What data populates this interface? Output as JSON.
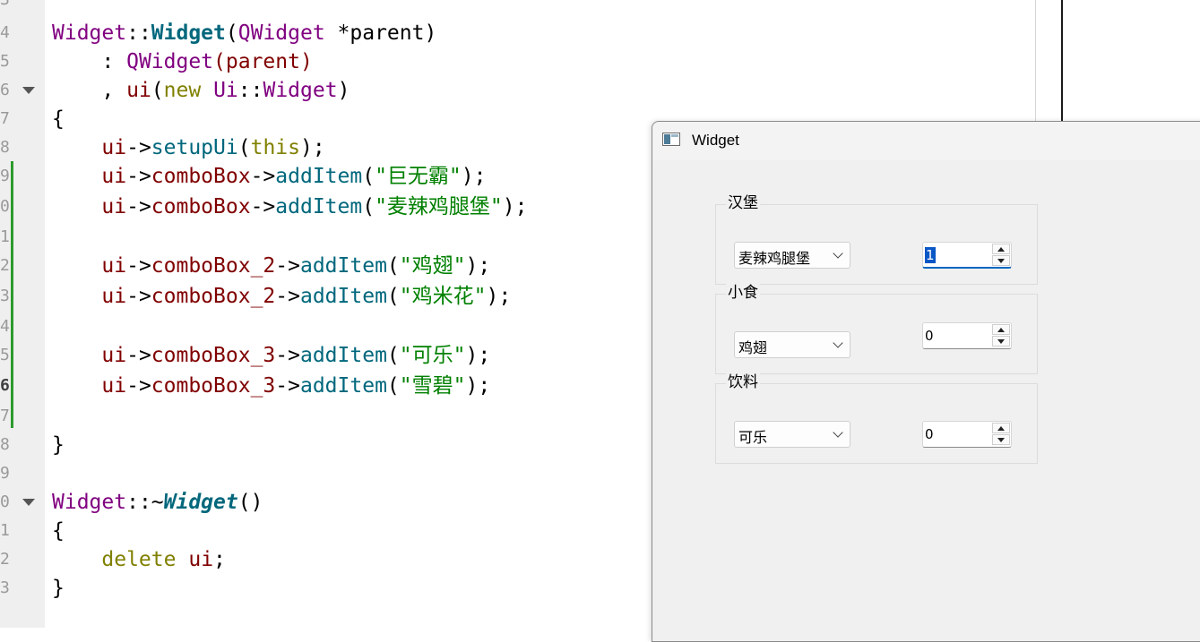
{
  "editor": {
    "line_numbers": [
      "3",
      "4",
      "5",
      "6",
      "7",
      "8",
      "9",
      "0",
      "1",
      "2",
      "3",
      "4",
      "5",
      "6",
      "7",
      "8",
      "9",
      "0",
      "1",
      "2",
      "3"
    ],
    "current_line_number": "6",
    "code": {
      "l4": {
        "cls": "Widget",
        "sep": "::",
        "fn": "Widget",
        "args_open": "(",
        "type": "QWidget",
        "rest": " *parent)"
      },
      "l5": {
        "lead": "    : ",
        "cls": "QWidget",
        "rest": "(parent)"
      },
      "l6": {
        "lead": "    , ",
        "member": "ui",
        "open": "(",
        "kw": "new",
        "sp": " ",
        "cls": "Ui",
        "sep": "::",
        "cls2": "Widget",
        "close": ")"
      },
      "l7": {
        "text": "{"
      },
      "l8": {
        "lead": "    ",
        "member": "ui",
        "arrow": "->",
        "call": "setupUi",
        "open": "(",
        "kw": "this",
        "close": ");"
      },
      "l9": {
        "lead": "    ",
        "member": "ui",
        "arrow": "->",
        "member2": "comboBox",
        "arrow2": "->",
        "call": "addItem",
        "open": "(",
        "str": "\"巨无霸\"",
        "close": ");"
      },
      "l10": {
        "lead": "    ",
        "member": "ui",
        "arrow": "->",
        "member2": "comboBox",
        "arrow2": "->",
        "call": "addItem",
        "open": "(",
        "str": "\"麦辣鸡腿堡\"",
        "close": ");"
      },
      "l12": {
        "lead": "    ",
        "member": "ui",
        "arrow": "->",
        "member2": "comboBox_2",
        "arrow2": "->",
        "call": "addItem",
        "open": "(",
        "str": "\"鸡翅\"",
        "close": ");"
      },
      "l13": {
        "lead": "    ",
        "member": "ui",
        "arrow": "->",
        "member2": "comboBox_2",
        "arrow2": "->",
        "call": "addItem",
        "open": "(",
        "str": "\"鸡米花\"",
        "close": ");"
      },
      "l15": {
        "lead": "    ",
        "member": "ui",
        "arrow": "->",
        "member2": "comboBox_3",
        "arrow2": "->",
        "call": "addItem",
        "open": "(",
        "str": "\"可乐\"",
        "close": ");"
      },
      "l16": {
        "lead": "    ",
        "member": "ui",
        "arrow": "->",
        "member2": "comboBox_3",
        "arrow2": "->",
        "call": "addItem",
        "open": "(",
        "str": "\"雪碧\"",
        "close": ");"
      },
      "l18": {
        "text": "}"
      },
      "l20": {
        "cls": "Widget",
        "sep": "::~",
        "fn": "Widget",
        "rest": "()"
      },
      "l21": {
        "text": "{"
      },
      "l22": {
        "lead": "    ",
        "kw": "delete",
        "sp": " ",
        "member": "ui",
        "rest": ";"
      },
      "l23": {
        "text": "}"
      }
    }
  },
  "window": {
    "title": "Widget",
    "groups": [
      {
        "title": "汉堡",
        "combo_value": "麦辣鸡腿堡",
        "spin_value": "1"
      },
      {
        "title": "小食",
        "combo_value": "鸡翅",
        "spin_value": "0"
      },
      {
        "title": "饮料",
        "combo_value": "可乐",
        "spin_value": "0"
      }
    ]
  },
  "colors": {
    "class": "#800080",
    "function": "#00677c",
    "member": "#800000",
    "keyword": "#808000",
    "string": "#008000",
    "selection": "#0a57c6",
    "focus_underline": "#0067c0"
  }
}
